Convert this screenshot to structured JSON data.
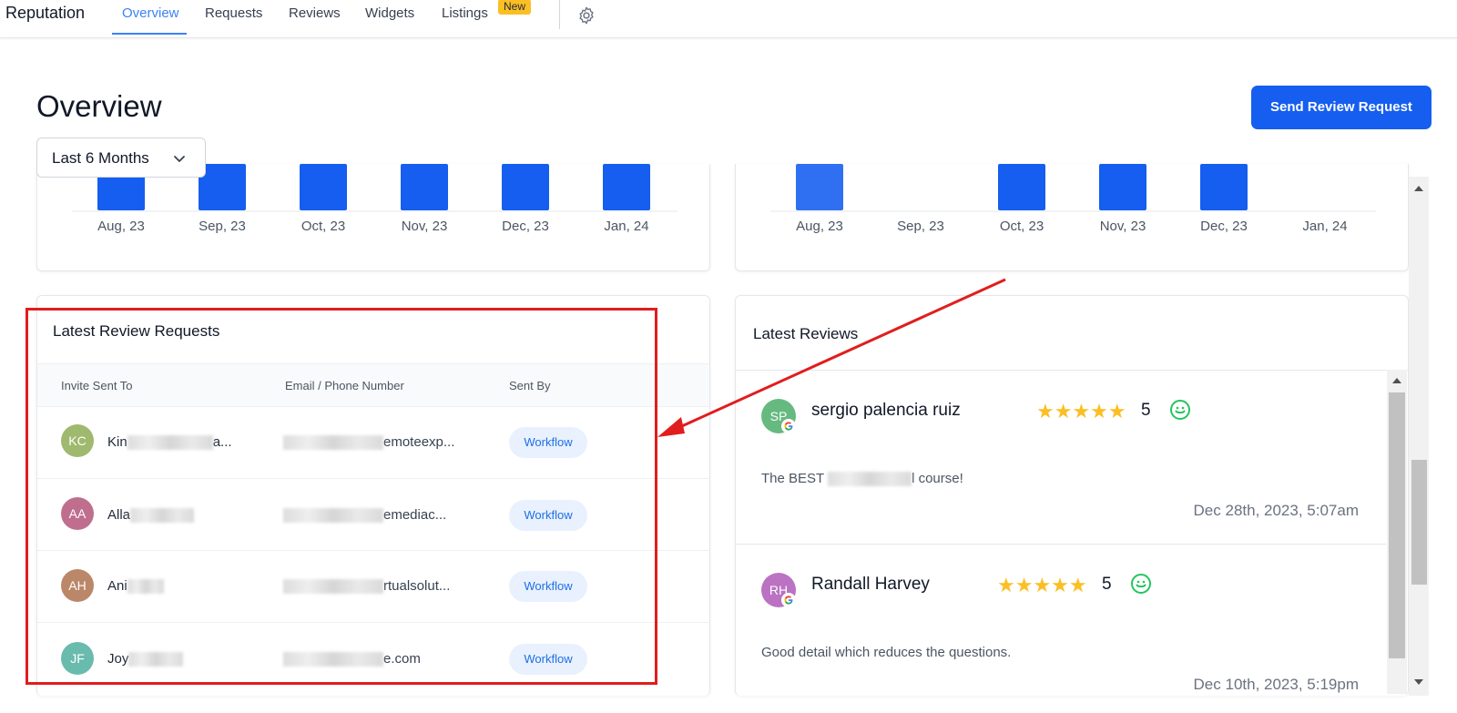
{
  "nav": {
    "brand": "Reputation",
    "tabs": [
      "Overview",
      "Requests",
      "Reviews",
      "Widgets",
      "Listings"
    ],
    "new_badge": "New",
    "active_tab": "Overview"
  },
  "header": {
    "title": "Overview",
    "range": "Last 6 Months",
    "primary_button": "Send Review Request"
  },
  "charts": {
    "left": {
      "categories": [
        "Aug, 23",
        "Sep, 23",
        "Oct, 23",
        "Nov, 23",
        "Dec, 23",
        "Jan, 24"
      ],
      "bars_present": [
        true,
        true,
        true,
        true,
        true,
        true
      ]
    },
    "right": {
      "categories": [
        "Aug, 23",
        "Sep, 23",
        "Oct, 23",
        "Nov, 23",
        "Dec, 23",
        "Jan, 24"
      ],
      "bars_present": [
        true,
        false,
        true,
        true,
        true,
        false
      ]
    },
    "bar_color": "#155eef"
  },
  "requests": {
    "title": "Latest Review Requests",
    "columns": [
      "Invite Sent To",
      "Email / Phone Number",
      "Sent By"
    ],
    "rows": [
      {
        "initials": "KC",
        "avatar_color": "#8fad55",
        "name_visible": "Kin",
        "name_tail": "a...",
        "email_tail": "emoteexp...",
        "sent_by": "Workflow"
      },
      {
        "initials": "AA",
        "avatar_color": "#b5577a",
        "name_visible": "Alla",
        "name_tail": "",
        "email_tail": "emediac...",
        "sent_by": "Workflow"
      },
      {
        "initials": "AH",
        "avatar_color": "#b07350",
        "name_visible": "Ani",
        "name_tail": "",
        "email_tail": "rtualsolut...",
        "sent_by": "Workflow"
      },
      {
        "initials": "JF",
        "avatar_color": "#4fb0a0",
        "name_visible": "Joy",
        "name_tail": "",
        "email_tail": "e.com",
        "sent_by": "Workflow"
      }
    ]
  },
  "reviews": {
    "title": "Latest Reviews",
    "items": [
      {
        "initials": "SP",
        "avatar_color": "#4caf6a",
        "name": "sergio palencia ruiz",
        "rating": 5,
        "stars": "★★★★★",
        "text_start": "The BEST",
        "text_end": "l course!",
        "date": "Dec 28th, 2023, 5:07am"
      },
      {
        "initials": "RH",
        "avatar_color": "#b05ab8",
        "name": "Randall Harvey",
        "rating": 5,
        "stars": "★★★★★",
        "text_start": "Good detail which reduces the questions.",
        "text_end": "",
        "date": "Dec 10th, 2023, 5:19pm"
      }
    ]
  },
  "colors": {
    "accent": "#155eef",
    "tab_active": "#3b82f6",
    "annotation": "#e11d1d",
    "star": "#fbbf24",
    "smile": "#22c55e"
  }
}
